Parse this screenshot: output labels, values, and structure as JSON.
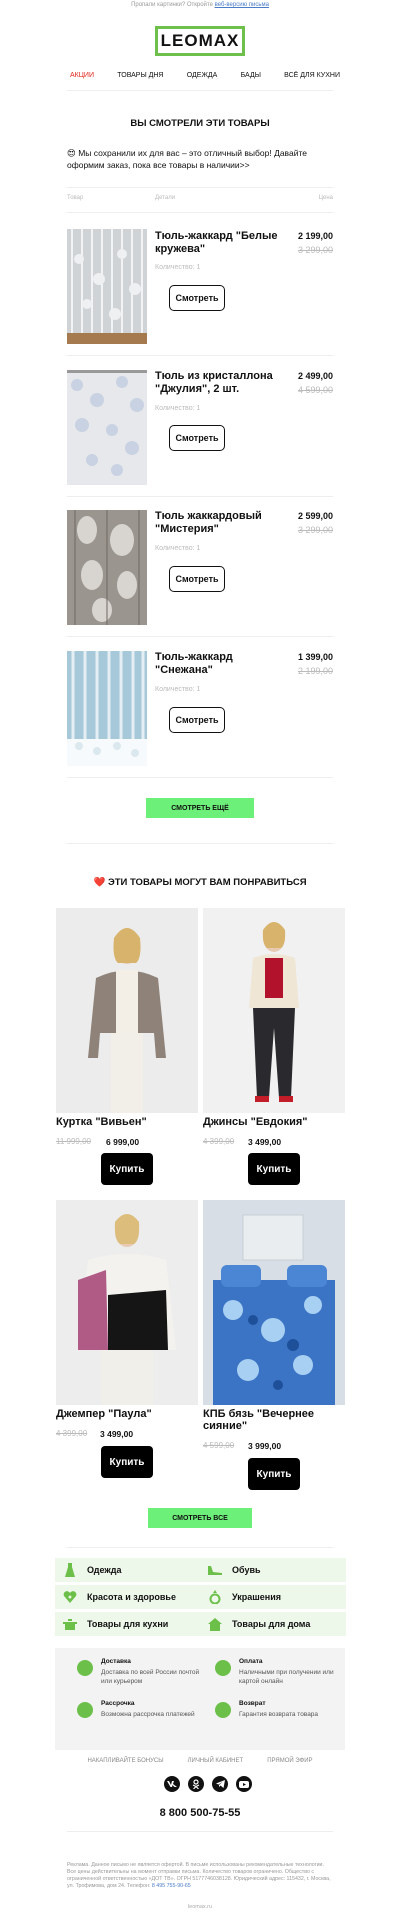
{
  "preheader": {
    "text": "Пропали картинки? Откройте ",
    "link": "веб-версию письма"
  },
  "logo": "LEOMAX",
  "nav": [
    "АКЦИИ",
    "ТОВАРЫ ДНЯ",
    "ОДЕЖДА",
    "БАДЫ",
    "ВСЁ ДЛЯ КУХНИ"
  ],
  "viewed": {
    "title": "ВЫ СМОТРЕЛИ ЭТИ ТОВАРЫ",
    "intro": "😍 Мы сохранили их для вас – это отличный выбор! Давайте оформим заказ, пока все товары в наличии>>",
    "headers": [
      "Товар",
      "Детали",
      "Цена"
    ],
    "items": [
      {
        "name": "Тюль-жаккард \"Белые кружева\"",
        "qty": "Количество: 1",
        "price": "2 199,00",
        "old": "3 299,00",
        "button": "Смотреть"
      },
      {
        "name": "Тюль из кристаллона \"Джулия\", 2 шт.",
        "qty": "Количество: 1",
        "price": "2 499,00",
        "old": "4 599,00",
        "button": "Смотреть"
      },
      {
        "name": "Тюль жаккардовый \"Мистерия\"",
        "qty": "Количество: 1",
        "price": "2 599,00",
        "old": "3 299,00",
        "button": "Смотреть"
      },
      {
        "name": "Тюль-жаккард \"Снежана\"",
        "qty": "Количество: 1",
        "price": "1 399,00",
        "old": "2 199,00",
        "button": "Смотреть"
      }
    ],
    "more_button": "СМОТРЕТЬ ЕЩЁ"
  },
  "recommend": {
    "title": "ЭТИ ТОВАРЫ МОГУТ ВАМ ПОНРАВИТЬСЯ",
    "items": [
      {
        "name": "Куртка \"Вивьен\"",
        "old": "11 999,00",
        "price": "6 999,00",
        "button": "Купить"
      },
      {
        "name": "Джинсы \"Евдокия\"",
        "old": "4 399,00",
        "price": "3 499,00",
        "button": "Купить"
      },
      {
        "name": "Джемпер \"Паула\"",
        "old": "4 399,00",
        "price": "3 499,00",
        "button": "Купить"
      },
      {
        "name": "КПБ бязь \"Вечернее сияние\"",
        "old": "4 599,00",
        "price": "3 999,00",
        "button": "Купить"
      }
    ],
    "all_button": "СМОТРЕТЬ ВСЕ"
  },
  "categories": [
    {
      "label": "Одежда",
      "icon": "dress-icon"
    },
    {
      "label": "Обувь",
      "icon": "shoe-icon"
    },
    {
      "label": "Красота и здоровье",
      "icon": "heart-plus-icon"
    },
    {
      "label": "Украшения",
      "icon": "ring-icon"
    },
    {
      "label": "Товары для кухни",
      "icon": "pot-icon"
    },
    {
      "label": "Товары для дома",
      "icon": "home-icon"
    }
  ],
  "info": [
    {
      "title": "Доставка",
      "desc": "Доставка по всей России почтой или курьером",
      "icon": "box-icon"
    },
    {
      "title": "Оплата",
      "desc": "Наличными при получении или картой онлайн",
      "icon": "ruble-icon"
    },
    {
      "title": "Рассрочка",
      "desc": "Возможна рассрочка платежей",
      "icon": "clock-icon"
    },
    {
      "title": "Возврат",
      "desc": "Гарантия возврата товара",
      "icon": "return-icon"
    }
  ],
  "footer_links": [
    "НАКАПЛИВАЙТЕ БОНУСЫ",
    "ЛИЧНЫЙ КАБИНЕТ",
    "ПРЯМОЙ ЭФИР"
  ],
  "social": [
    "VK",
    "OK",
    "TG",
    "YT"
  ],
  "phone": "8 800 500-75-55",
  "legal": "Реклама. Данное письмо не является офертой. В письме использованы рекомендательные технологии. Все цены действительны на момент отправки письма. Количество товаров ограничено. Общество с ограниченной ответственностью «ДОТ ТВ». ОГРН 5177746038128. Юридический адрес: 115432, г. Москва, ул. Трофимова, дом 24. Телефон: ",
  "legal_phone": "8 495 755-90-65",
  "site": "leomax.ru",
  "colors": {
    "brand_green": "#6dc04b",
    "button_green": "#6df07a",
    "red": "#e1251b"
  }
}
